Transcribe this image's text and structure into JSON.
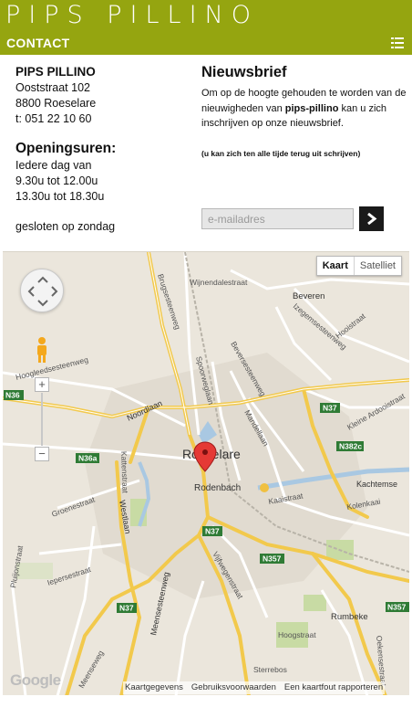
{
  "header": {
    "logo_text": "PIPS PILLINO",
    "section_title": "CONTACT",
    "menu_icon": "menu-icon",
    "background_color": "#95a510"
  },
  "contact": {
    "name": "PIPS PILLINO",
    "street": "Ooststraat 102",
    "city": "8800 Roeselare",
    "phone": "t: 051 22 10 60",
    "opening_title": "Openingsuren:",
    "opening_days": "Iedere dag van",
    "opening_morning": "9.30u tot 12.00u",
    "opening_afternoon": "13.30u tot 18.30u",
    "closed": "gesloten op zondag"
  },
  "newsletter": {
    "title": "Nieuwsbrief",
    "desc_before": "Om op de hoogte gehouden te worden van de nieuwigheden van ",
    "desc_brand": "pips-pillino",
    "desc_after": " kan u zich inschrijven op onze nieuwsbrief.",
    "note": "(u kan zich ten alle tijde terug uit schrijven)",
    "email_placeholder": "e-mailadres",
    "submit_icon": "chevron-right-icon"
  },
  "map": {
    "type_map": "Kaart",
    "type_satellite": "Satelliet",
    "zoom_in": "+",
    "zoom_out": "−",
    "logo": "Google",
    "footer_data": "Kaartgegevens",
    "footer_terms": "Gebruiksvoorwaarden",
    "footer_report": "Een kaartfout rapporteren",
    "labels": {
      "wijnendalestraat": "Wijnendalestraat",
      "beveren": "Beveren",
      "izegemsesteenweg": "Izegemsesteenweg",
      "hooistraat": "Hooistraat",
      "brugsesteenweg": "Brugsesteenweg",
      "spoorweglaan": "Spoorweglaan",
      "beversesteenweg": "Beversesteenweg",
      "noordlaan": "Noordlaan",
      "hoogleedsesteenweg": "Hoogleedsesteenweg",
      "n36": "N36",
      "n37_top": "N37",
      "kleine_ardooistraat": "Kleine Ardooistraat",
      "mandellaan": "Mandellaan",
      "n382c": "N382c",
      "roeselare": "Roeselare",
      "kattenstraat": "Kattenstraat",
      "n36a": "N36a",
      "kachtemse": "Kachtemse",
      "rodenbach": "Rodenbach",
      "kaaistraat": "Kaaistraat",
      "kolenkaai": "Kolenkaai",
      "groenestraat": "Groenestraat",
      "westlaan": "Westlaan",
      "n37_mid": "N37",
      "ieperseestraat": "Iepersestraat",
      "vijfwegenstraat": "Vijfwegenstraat",
      "n357": "N357",
      "pluijonstraat": "Pluijonstraat",
      "meensesteenweg": "Meensesteenweg",
      "n37_low": "N37",
      "rumbeke": "Rumbeke",
      "hoogstraat": "Hoogstraat",
      "n357_right": "N357",
      "oekensestraat": "Oekensestraat",
      "sterrebos": "Sterrebos",
      "meenseweg": "Meenseweg"
    }
  }
}
